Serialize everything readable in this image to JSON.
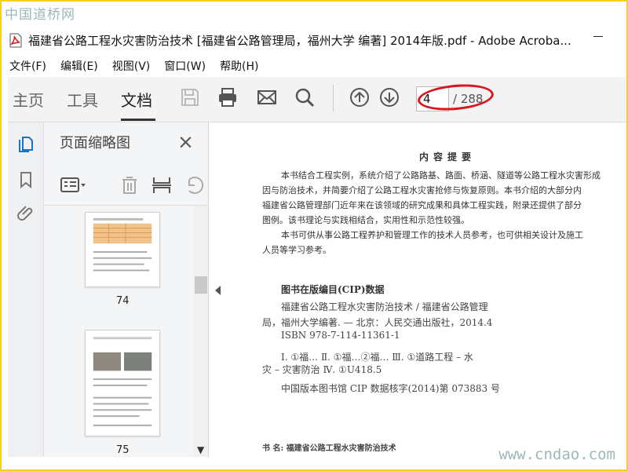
{
  "watermarks": {
    "top": "中国道桥网",
    "bottom": "www.cndao.com"
  },
  "window": {
    "title": "福建省公路工程水灾害防治技术 [福建省公路管理局，福州大学 编著] 2014年版.pdf - Adobe Acroba...",
    "minimize": "—"
  },
  "menu": {
    "items": [
      "文件(F)",
      "编辑(E)",
      "视图(V)",
      "窗口(W)",
      "帮助(H)"
    ]
  },
  "toolbar": {
    "tabs": [
      "主页",
      "工具",
      "文档"
    ],
    "current_page": "4",
    "total_pages": "/ 288"
  },
  "panel": {
    "title": "页面缩略图",
    "close": "×",
    "page_labels": [
      "74",
      "75"
    ]
  },
  "doc": {
    "title": "内容提要",
    "intro": [
      "本书结合工程实例，系统介绍了公路路基、路面、桥涵、隧道等公路工程水灾害形成",
      "因与防治技术，并简要介绍了公路工程水灾害抢修与恢复原则。本书介绍的大部分内",
      "福建省公路管理部门近年来在该领域的研究成果和具体工程实践，附录还提供了部分",
      "图例。该书理论与实践相结合，实用性和示范性较强。",
      "本书可供从事公路工程养护和管理工作的技术人员参考，也可供相关设计及施工",
      "人员等学习参考。"
    ],
    "cip_heading": "图书在版编目(CIP)数据",
    "cip": [
      "福建省公路工程水灾害防治技术 / 福建省公路管理",
      "局，福州大学编著. — 北京：人民交通出版社，2014.4",
      "ISBN 978-7-114-11361-1",
      "Ⅰ. ①福…   Ⅱ. ①福…②福…   Ⅲ. ①道路工程 – 水",
      "灾 – 灾害防治   Ⅳ. ①U418.5",
      "中国版本图书馆 CIP 数据核字(2014)第 073883 号"
    ],
    "book_name": "书    名: 福建省公路工程水灾害防治技术"
  }
}
